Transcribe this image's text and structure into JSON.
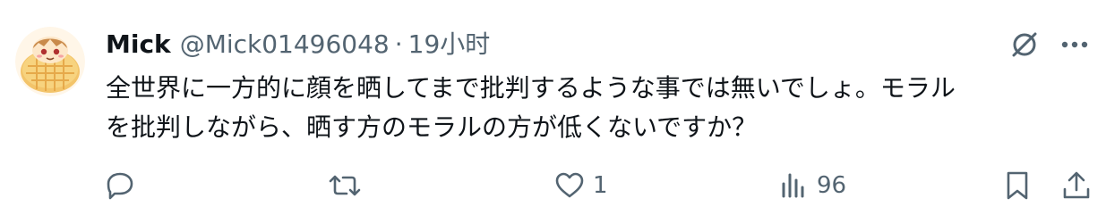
{
  "post": {
    "author_name": "Mick",
    "author_handle": "@Mick01496048",
    "separator": "·",
    "timestamp": "19小时",
    "text_line1": "全世界に一方的に顔を晒してまで批判するような事では無いでしょ。モラル",
    "text_line2": "を批判しながら、晒す方のモラルの方が低くないですか？"
  },
  "actions": {
    "reply_count": "",
    "repost_count": "",
    "like_count": "1",
    "views_count": "96"
  },
  "icons": {
    "grok": "grok-icon",
    "more": "more-icon",
    "reply": "reply-icon",
    "repost": "repost-icon",
    "like": "like-icon",
    "views": "views-icon",
    "bookmark": "bookmark-icon",
    "share": "share-icon"
  },
  "colors": {
    "text": "#0f1419",
    "secondary": "#536471",
    "background": "#ffffff"
  }
}
